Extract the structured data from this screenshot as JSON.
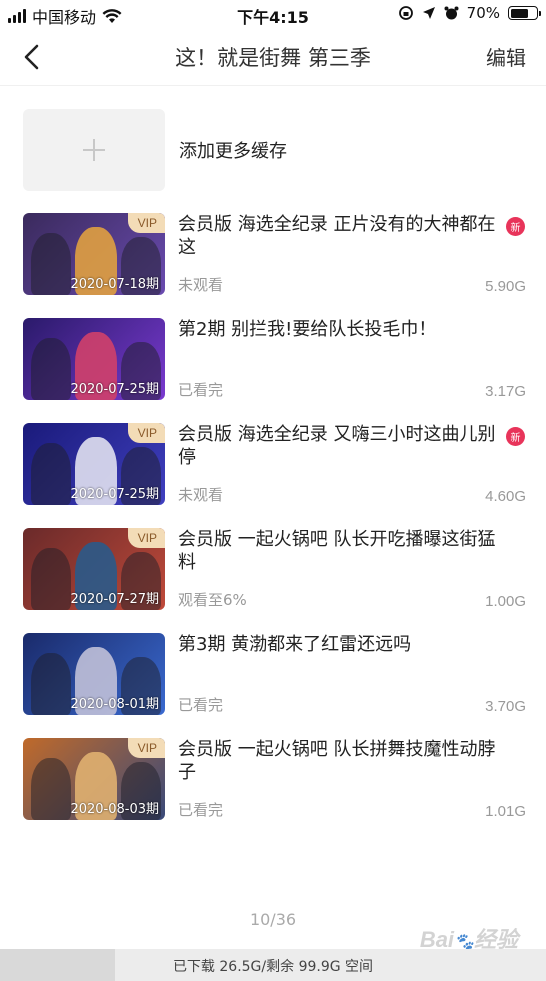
{
  "status_bar": {
    "carrier": "中国移动",
    "time": "下午4:15",
    "battery": "70%",
    "battery_level": 0.7
  },
  "nav": {
    "title": "这！就是街舞 第三季",
    "edit_label": "编辑",
    "back_icon": "chevron-left-icon"
  },
  "add_more": {
    "label": "添加更多缓存",
    "icon": "plus-icon"
  },
  "episodes": [
    {
      "title": "会员版 海选全纪录 正片没有的大神都在这",
      "date": "2020-07-18期",
      "vip": "VIP",
      "is_new": true,
      "new_label": "新",
      "status": "未观看",
      "size": "5.90G",
      "colors": [
        "#3a2a5c",
        "#6a4bb0",
        "#e0a040"
      ]
    },
    {
      "title": "第2期 别拦我!要给队长投毛巾！",
      "date": "2020-07-25期",
      "vip": "",
      "is_new": false,
      "new_label": "",
      "status": "已看完",
      "size": "3.17G",
      "colors": [
        "#2a1a6a",
        "#7a3ad0",
        "#d0406a"
      ]
    },
    {
      "title": "会员版 海选全纪录 又嗨三小时这曲儿别停",
      "date": "2020-07-25期",
      "vip": "VIP",
      "is_new": true,
      "new_label": "新",
      "status": "未观看",
      "size": "4.60G",
      "colors": [
        "#1a1a7a",
        "#4040c0",
        "#e0e0f0"
      ]
    },
    {
      "title": "会员版 一起火锅吧 队长开吃播曝这街猛料",
      "date": "2020-07-27期",
      "vip": "VIP",
      "is_new": false,
      "new_label": "",
      "status": "观看至6%",
      "size": "1.00G",
      "colors": [
        "#6a2a2a",
        "#c04a3a",
        "#2a5a8a"
      ]
    },
    {
      "title": "第3期 黄渤都来了红雷还远吗",
      "date": "2020-08-01期",
      "vip": "",
      "is_new": false,
      "new_label": "",
      "status": "已看完",
      "size": "3.70G",
      "colors": [
        "#1a2a6a",
        "#3a6ad0",
        "#c0c0d8"
      ]
    },
    {
      "title": "会员版 一起火锅吧 队长拼舞技魔性动脖子",
      "date": "2020-08-03期",
      "vip": "VIP",
      "is_new": false,
      "new_label": "",
      "status": "已看完",
      "size": "1.01G",
      "colors": [
        "#c06a2a",
        "#3a4a7a",
        "#e0b070"
      ]
    }
  ],
  "pager": "10/36",
  "storage": {
    "text": "已下载 26.5G/剩余 99.9G 空间",
    "used_fraction": 0.21
  },
  "watermark": "Bai 经验",
  "accent": "#e8345a"
}
